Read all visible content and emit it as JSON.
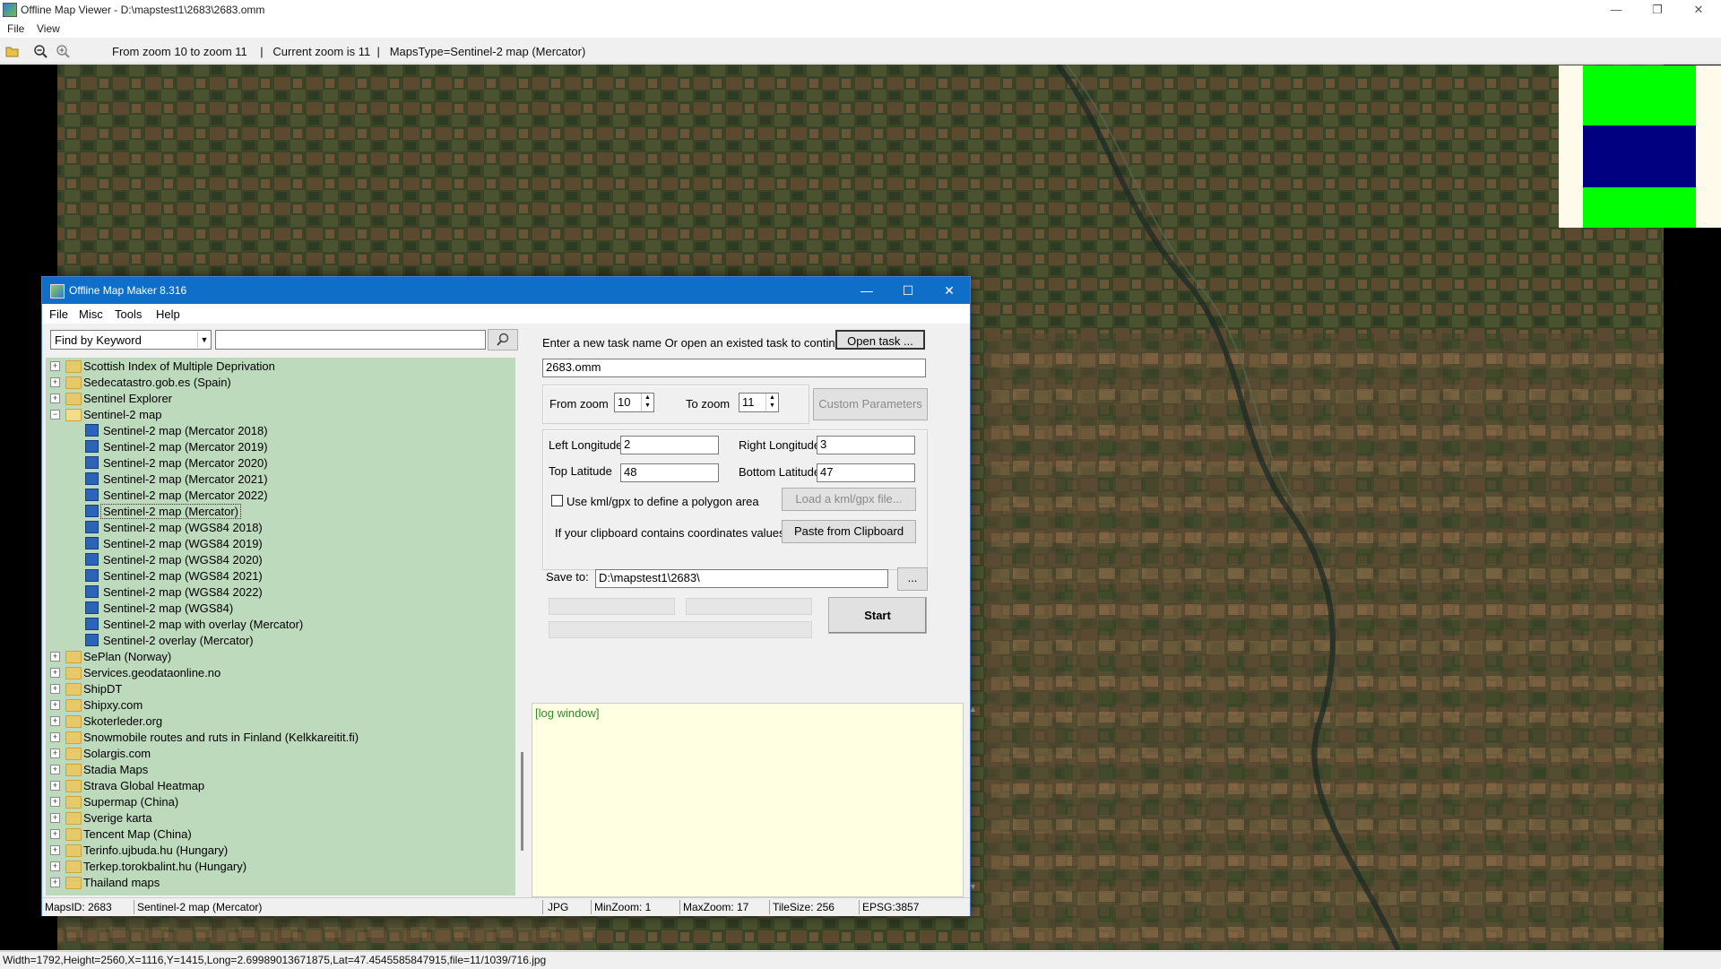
{
  "outer": {
    "title": "Offline Map Viewer - D:\\mapstest1\\2683\\2683.omm",
    "menu": [
      "File",
      "View"
    ],
    "toolbar_info": "From zoom 10 to zoom 11    |   Current zoom is 11  |   MapsType=Sentinel-2 map (Mercator)",
    "status": "Width=1792,Height=2560,X=1116,Y=1415,Long=2.69989013671875,Lat=47.4545585847915,file=11/1039/716.jpg"
  },
  "legend_colors": [
    "#00ff00",
    "#000080",
    "#00ff00"
  ],
  "dialog": {
    "title": "Offline Map Maker 8.316",
    "menu": [
      "File",
      "Misc",
      "Tools",
      "Help"
    ],
    "search": {
      "mode": "Find by Keyword",
      "value": ""
    },
    "tree": [
      {
        "label": "Scottish Index of Multiple Deprivation",
        "type": "folder",
        "expanded": false
      },
      {
        "label": "Sedecatastro.gob.es (Spain)",
        "type": "folder",
        "expanded": false
      },
      {
        "label": "Sentinel Explorer",
        "type": "folder",
        "expanded": false
      },
      {
        "label": "Sentinel-2 map",
        "type": "folder",
        "expanded": true
      },
      {
        "label": "Sentinel-2 map (Mercator 2018)",
        "type": "leaf"
      },
      {
        "label": "Sentinel-2 map (Mercator 2019)",
        "type": "leaf"
      },
      {
        "label": "Sentinel-2 map (Mercator 2020)",
        "type": "leaf"
      },
      {
        "label": "Sentinel-2 map (Mercator 2021)",
        "type": "leaf"
      },
      {
        "label": "Sentinel-2 map (Mercator 2022)",
        "type": "leaf"
      },
      {
        "label": "Sentinel-2 map (Mercator)",
        "type": "leaf",
        "selected": true
      },
      {
        "label": "Sentinel-2 map (WGS84 2018)",
        "type": "leaf"
      },
      {
        "label": "Sentinel-2 map (WGS84 2019)",
        "type": "leaf"
      },
      {
        "label": "Sentinel-2 map (WGS84 2020)",
        "type": "leaf"
      },
      {
        "label": "Sentinel-2 map (WGS84 2021)",
        "type": "leaf"
      },
      {
        "label": "Sentinel-2 map (WGS84 2022)",
        "type": "leaf"
      },
      {
        "label": "Sentinel-2 map (WGS84)",
        "type": "leaf"
      },
      {
        "label": "Sentinel-2 map with overlay (Mercator)",
        "type": "leaf"
      },
      {
        "label": "Sentinel-2 overlay (Mercator)",
        "type": "leaf"
      },
      {
        "label": "SePlan (Norway)",
        "type": "folder",
        "expanded": false
      },
      {
        "label": "Services.geodataonline.no",
        "type": "folder",
        "expanded": false
      },
      {
        "label": "ShipDT",
        "type": "folder",
        "expanded": false
      },
      {
        "label": "Shipxy.com",
        "type": "folder",
        "expanded": false
      },
      {
        "label": "Skoterleder.org",
        "type": "folder",
        "expanded": false
      },
      {
        "label": "Snowmobile routes and ruts in Finland (Kelkkareitit.fi)",
        "type": "folder",
        "expanded": false
      },
      {
        "label": "Solargis.com",
        "type": "folder",
        "expanded": false
      },
      {
        "label": "Stadia Maps",
        "type": "folder",
        "expanded": false
      },
      {
        "label": "Strava Global Heatmap",
        "type": "folder",
        "expanded": false
      },
      {
        "label": "Supermap (China)",
        "type": "folder",
        "expanded": false
      },
      {
        "label": "Sverige karta",
        "type": "folder",
        "expanded": false
      },
      {
        "label": "Tencent Map (China)",
        "type": "folder",
        "expanded": false
      },
      {
        "label": "Terinfo.ujbuda.hu (Hungary)",
        "type": "folder",
        "expanded": false
      },
      {
        "label": "Terkep.torokbalint.hu (Hungary)",
        "type": "folder",
        "expanded": false
      },
      {
        "label": "Thailand maps",
        "type": "folder",
        "expanded": false
      }
    ],
    "task_prompt": "Enter a new task name Or open an existed task to continue:",
    "open_task_label": "Open task ...",
    "task_name": "2683.omm",
    "from_zoom_label": "From zoom",
    "from_zoom": "10",
    "to_zoom_label": "To zoom",
    "to_zoom": "11",
    "custom_params_label": "Custom Parameters",
    "left_lon_label": "Left Longitude",
    "left_lon": "2",
    "right_lon_label": "Right Longitude",
    "right_lon": "3",
    "top_lat_label": "Top Latitude",
    "top_lat": "48",
    "bottom_lat_label": "Bottom Latitude",
    "bottom_lat": "47",
    "kml_label": "Use kml/gpx to define a polygon area",
    "load_kml_label": "Load a kml/gpx file...",
    "clipboard_label": "If your clipboard contains coordinates values:",
    "paste_label": "Paste from Clipboard",
    "save_to_label": "Save to:",
    "save_to": "D:\\mapstest1\\2683\\",
    "browse_label": "...",
    "start_label": "Start",
    "log_text": "[log window]",
    "status": {
      "maps_id": "MapsID: 2683",
      "map_name": "Sentinel-2 map (Mercator)",
      "format": "JPG",
      "min_zoom": "MinZoom: 1",
      "max_zoom": "MaxZoom: 17",
      "tile_size": "TileSize: 256",
      "epsg": "EPSG:3857"
    }
  }
}
